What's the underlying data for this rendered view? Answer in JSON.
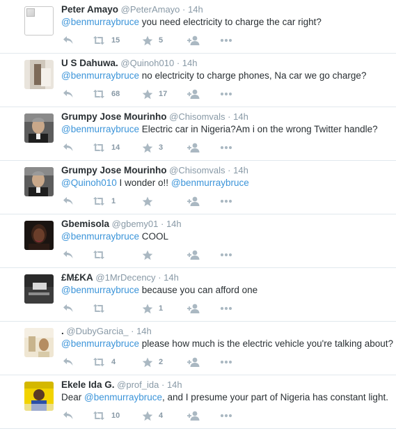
{
  "tweets": [
    {
      "avatar": "broken",
      "name": "Peter Amayo",
      "handle": "@PeterAmayo",
      "dot": "·",
      "time": "14h",
      "segments": [
        {
          "m": true,
          "t": "@benmurraybruce"
        },
        {
          "m": false,
          "t": " you need electricity to charge the car right?"
        }
      ],
      "retweets": "15",
      "likes": "5"
    },
    {
      "avatar": "photo-light",
      "name": "U S Dahuwa.",
      "handle": "@Quinoh010",
      "dot": "·",
      "time": "14h",
      "segments": [
        {
          "m": true,
          "t": "@benmurraybruce"
        },
        {
          "m": false,
          "t": " no electricity to charge phones, Na car we go charge?"
        }
      ],
      "retweets": "68",
      "likes": "17"
    },
    {
      "avatar": "photo-mourinho",
      "name": "Grumpy Jose Mourinho",
      "handle": "@Chisomvals",
      "dot": "·",
      "time": "14h",
      "segments": [
        {
          "m": true,
          "t": "@benmurraybruce"
        },
        {
          "m": false,
          "t": " Electric  car in Nigeria?Am i on the wrong Twitter handle?"
        }
      ],
      "retweets": "14",
      "likes": "3"
    },
    {
      "avatar": "photo-mourinho",
      "name": "Grumpy Jose Mourinho",
      "handle": "@Chisomvals",
      "dot": "·",
      "time": "14h",
      "segments": [
        {
          "m": true,
          "t": "@Quinoh010"
        },
        {
          "m": false,
          "t": " I wonder o!! "
        },
        {
          "m": true,
          "t": "@benmurraybruce"
        }
      ],
      "retweets": "1",
      "likes": ""
    },
    {
      "avatar": "photo-woman",
      "name": "Gbemisola",
      "handle": "@gbemy01",
      "dot": "·",
      "time": "14h",
      "segments": [
        {
          "m": true,
          "t": "@benmurraybruce"
        },
        {
          "m": false,
          "t": "  COOL"
        }
      ],
      "retweets": "",
      "likes": ""
    },
    {
      "avatar": "photo-dark",
      "name": "£M£KA",
      "handle": "@1MrDecency",
      "dot": "·",
      "time": "14h",
      "segments": [
        {
          "m": true,
          "t": "@benmurraybruce"
        },
        {
          "m": false,
          "t": " because you can afford one"
        }
      ],
      "retweets": "",
      "likes": "1"
    },
    {
      "avatar": "photo-room",
      "name": ".",
      "handle": "@DubyGarcia_",
      "dot": "·",
      "time": "14h",
      "segments": [
        {
          "m": true,
          "t": "@benmurraybruce"
        },
        {
          "m": false,
          "t": " please how much is the electric vehicle you're talking about?"
        }
      ],
      "retweets": "4",
      "likes": "2"
    },
    {
      "avatar": "photo-ida",
      "name": "Ekele Ida G.",
      "handle": "@prof_ida",
      "dot": "·",
      "time": "14h",
      "segments": [
        {
          "m": false,
          "t": "Dear "
        },
        {
          "m": true,
          "t": "@benmurraybruce"
        },
        {
          "m": false,
          "t": ", and I presume your part of Nigeria has constant light."
        }
      ],
      "retweets": "10",
      "likes": "4"
    }
  ],
  "icons": {
    "reply": "reply-icon",
    "retweet": "retweet-icon",
    "like": "star-icon",
    "follow": "follow-icon",
    "more": "more-icon"
  },
  "colors": {
    "mention": "#3b94d9",
    "meta": "#8899a6",
    "icon": "#aab8c2",
    "text": "#292f33",
    "divider": "#e1e8ed"
  }
}
